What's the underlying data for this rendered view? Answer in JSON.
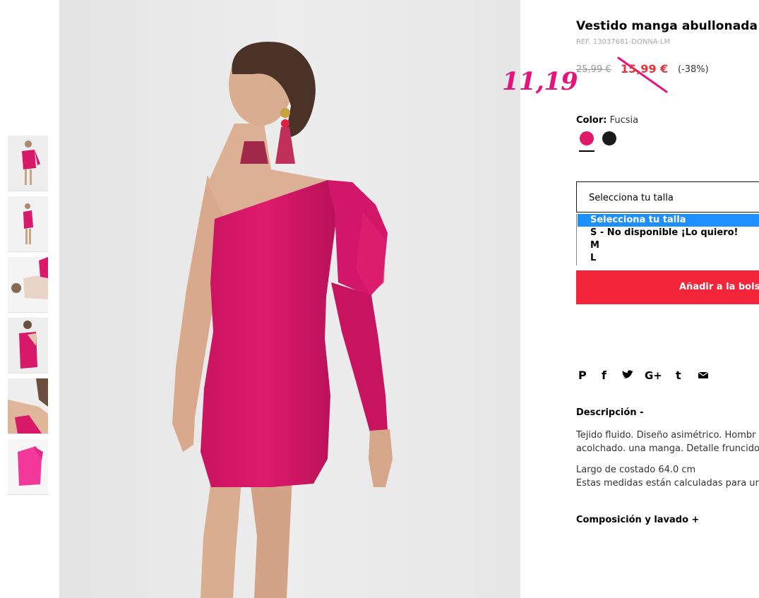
{
  "product": {
    "title": "Vestido manga abullonada",
    "ref": "REF. 13037681-DONNA-LM",
    "old_price": "25,99 €",
    "new_price": "15,99 €",
    "discount": "(-38%)",
    "handwritten_price": "11,19"
  },
  "color": {
    "label": "Color:",
    "value": "Fucsia",
    "swatches": [
      {
        "name": "Fucsia",
        "hex": "#e0196b"
      },
      {
        "name": "Negro",
        "hex": "#1a1a1a"
      }
    ]
  },
  "size": {
    "current": "Selecciona tu talla",
    "options": [
      "Selecciona tu talla",
      "S - No disponible ¡Lo quiero!",
      "M",
      "L"
    ]
  },
  "add_button": "Añadir a la bolsa",
  "share_icons": [
    "pinterest-icon",
    "facebook-icon",
    "twitter-icon",
    "google-plus-icon",
    "tumblr-icon",
    "email-icon"
  ],
  "description": {
    "heading": "Descripción -",
    "line1": "Tejido fluido. Diseño asimétrico. Hombr",
    "line2": "acolchado. una manga. Detalle fruncido",
    "line3": "Largo de costado 64.0 cm",
    "line4": "Estas medidas están calculadas para ur"
  },
  "composition_heading": "Composición y lavado +",
  "colors": {
    "accent_red": "#f3253a",
    "price_red": "#e8313a",
    "handwriting_pink": "#e6137d",
    "dress": "#d81868"
  }
}
